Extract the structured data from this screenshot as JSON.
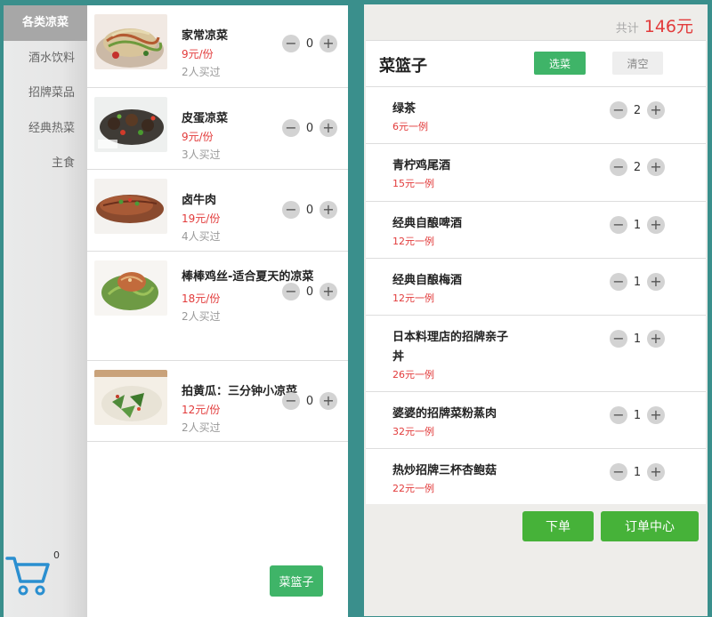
{
  "menu": {
    "categories": [
      {
        "label": "各类凉菜",
        "active": true
      },
      {
        "label": "酒水饮料",
        "active": false
      },
      {
        "label": "招牌菜品",
        "active": false
      },
      {
        "label": "经典热菜",
        "active": false
      },
      {
        "label": "主食",
        "active": false
      }
    ],
    "cart": {
      "icon": "shopping-cart-icon",
      "count": "0",
      "color": "#2a8fd0"
    },
    "dishes": [
      {
        "name": "家常凉菜",
        "price": "9元/份",
        "buyers": "2人买过",
        "qty": "0",
        "image": "noodle-salad-image"
      },
      {
        "name": "皮蛋凉菜",
        "price": "9元/份",
        "buyers": "3人买过",
        "qty": "0",
        "image": "preserved-egg-salad-image"
      },
      {
        "name": "卤牛肉",
        "price": "19元/份",
        "buyers": "4人买过",
        "qty": "0",
        "image": "braised-beef-image"
      },
      {
        "name": "棒棒鸡丝-适合夏天的凉菜",
        "price": "18元/份",
        "buyers": "2人买过",
        "qty": "0",
        "image": "shredded-chicken-image"
      },
      {
        "name": "拍黄瓜：三分钟小凉菜",
        "price": "12元/份",
        "buyers": "2人买过",
        "qty": "0",
        "image": "smashed-cucumber-image"
      }
    ],
    "basket_button_label": "菜篮子"
  },
  "basket": {
    "total_label": "共计",
    "total_value": "146元",
    "title": "菜篮子",
    "select_label": "选菜",
    "clear_label": "清空",
    "items": [
      {
        "name": "绿茶",
        "price": "6元一例",
        "qty": "2"
      },
      {
        "name": "青柠鸡尾酒",
        "price": "15元一例",
        "qty": "2"
      },
      {
        "name": "经典自酿啤酒",
        "price": "12元一例",
        "qty": "1"
      },
      {
        "name": "经典自酿梅酒",
        "price": "12元一例",
        "qty": "1"
      },
      {
        "name": "日本料理店的招牌亲子丼",
        "price": "26元一例",
        "qty": "1"
      },
      {
        "name": "婆婆的招牌菜粉蒸肉",
        "price": "32元一例",
        "qty": "1"
      },
      {
        "name": "热炒招牌三杯杏鲍菇",
        "price": "22元一例",
        "qty": "1"
      }
    ],
    "order_label": "下单",
    "order_center_label": "订单中心"
  },
  "icons": {
    "minus": "−",
    "plus": "+"
  },
  "colors": {
    "accent_green": "#3fb468",
    "price_red": "#e23b3b",
    "background_teal": "#3a8f8c"
  }
}
